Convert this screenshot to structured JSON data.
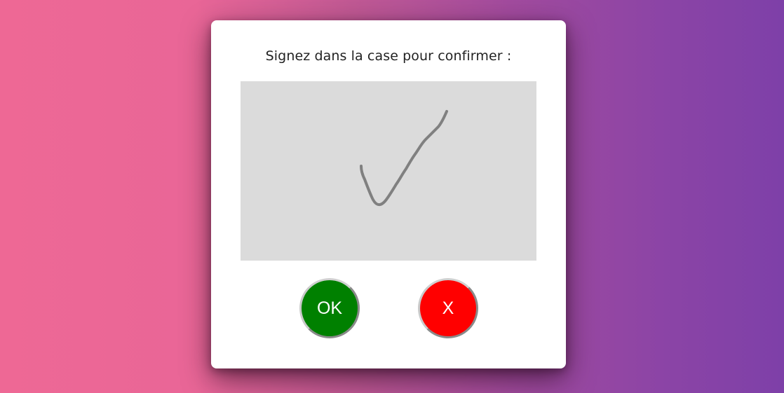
{
  "dialog": {
    "prompt": "Signez dans la case pour confirmer :",
    "signature_pad": {
      "background": "#dbdbdb",
      "stroke_color": "#808080",
      "content": "check-mark-signature"
    },
    "buttons": {
      "ok_label": "OK",
      "ok_color": "#008000",
      "cancel_label": "X",
      "cancel_color": "#ff0000"
    }
  },
  "colors": {
    "background_gradient_start": "#ee6895",
    "background_gradient_end": "#7e40a8",
    "dialog_background": "#ffffff"
  }
}
